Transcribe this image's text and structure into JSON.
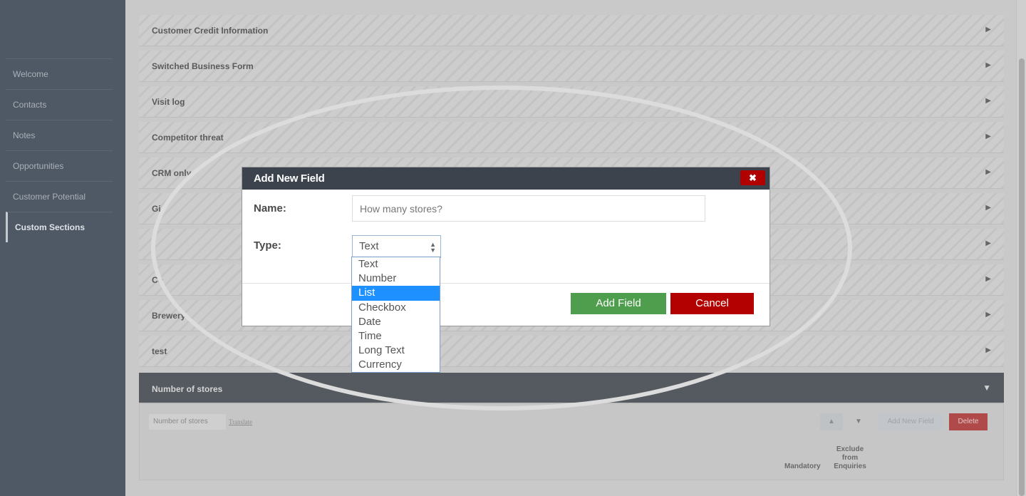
{
  "sidebar": {
    "items": [
      {
        "label": "Welcome"
      },
      {
        "label": "Contacts"
      },
      {
        "label": "Notes"
      },
      {
        "label": "Opportunities"
      },
      {
        "label": "Customer Potential"
      },
      {
        "label": "Custom Sections"
      }
    ],
    "active_index": 5
  },
  "sections": [
    {
      "label": "Customer Credit Information"
    },
    {
      "label": "Switched Business Form"
    },
    {
      "label": "Visit log"
    },
    {
      "label": "Competitor threat"
    },
    {
      "label": "CRM only"
    },
    {
      "label": "Gi"
    },
    {
      "label": ""
    },
    {
      "label": "Co"
    },
    {
      "label": "Brewery"
    },
    {
      "label": "test"
    }
  ],
  "expanded_section": {
    "label": "Number of stores",
    "name_value": "Number of stores",
    "translate_link": "Translate",
    "up_label": "▲",
    "down_label": "▼",
    "add_field_label": "Add New Field",
    "delete_label": "Delete",
    "columns": {
      "mandatory": "Mandatory",
      "exclude": "Exclude from Enquiries"
    }
  },
  "modal": {
    "title": "Add New Field",
    "close_label": "✖",
    "name_label": "Name:",
    "name_value": "How many stores?",
    "type_label": "Type:",
    "type_value": "Text",
    "type_options": [
      "Text",
      "Number",
      "List",
      "Checkbox",
      "Date",
      "Time",
      "Long Text",
      "Currency"
    ],
    "highlighted_option": "List",
    "add_button": "Add Field",
    "cancel_button": "Cancel"
  },
  "colors": {
    "add_button": "#4e9e4e",
    "cancel_button": "#b30000",
    "modal_header": "#3c434c",
    "highlight": "#1e90ff"
  }
}
